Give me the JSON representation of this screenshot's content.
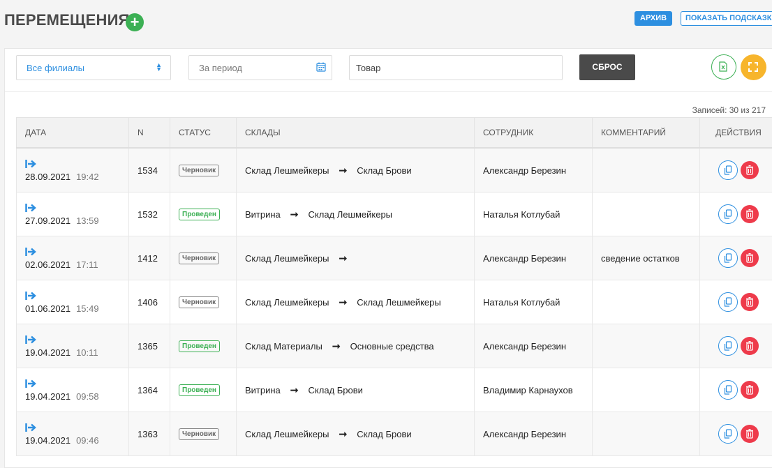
{
  "header": {
    "title": "ПЕРЕМЕЩЕНИЯ",
    "add_icon": "plus-icon",
    "archive_label": "АРХИВ",
    "hint_label": "ПОКАЗАТЬ ПОДСКАЗКУ"
  },
  "filters": {
    "branch_value": "Все филиалы",
    "period_placeholder": "За период",
    "product_placeholder": "Товар",
    "reset_label": "СБРОС"
  },
  "records_text": "Записей: 30 из 217",
  "table": {
    "columns": [
      "ДАТА",
      "N",
      "СТАТУС",
      "СКЛАДЫ",
      "СОТРУДНИК",
      "КОММЕНТАРИЙ",
      "ДЕЙСТВИЯ"
    ],
    "rows": [
      {
        "date": "28.09.2021",
        "time": "19:42",
        "n": "1534",
        "status": "Черновик",
        "status_type": "draft",
        "from": "Склад Лешмейкеры",
        "to": "Склад Брови",
        "employee": "Александр Березин",
        "comment": ""
      },
      {
        "date": "27.09.2021",
        "time": "13:59",
        "n": "1532",
        "status": "Проведен",
        "status_type": "done",
        "from": "Витрина",
        "to": "Склад Лешмейкеры",
        "employee": "Наталья Котлубай",
        "comment": ""
      },
      {
        "date": "02.06.2021",
        "time": "17:11",
        "n": "1412",
        "status": "Черновик",
        "status_type": "draft",
        "from": "Склад Лешмейкеры",
        "to": "",
        "employee": "Александр Березин",
        "comment": "сведение остатков"
      },
      {
        "date": "01.06.2021",
        "time": "15:49",
        "n": "1406",
        "status": "Черновик",
        "status_type": "draft",
        "from": "Склад Лешмейкеры",
        "to": "Склад Лешмейкеры",
        "employee": "Наталья Котлубай",
        "comment": ""
      },
      {
        "date": "19.04.2021",
        "time": "10:11",
        "n": "1365",
        "status": "Проведен",
        "status_type": "done",
        "from": "Склад Материалы",
        "to": "Основные средства",
        "employee": "Александр Березин",
        "comment": ""
      },
      {
        "date": "19.04.2021",
        "time": "09:58",
        "n": "1364",
        "status": "Проведен",
        "status_type": "done",
        "from": "Витрина",
        "to": "Склад Брови",
        "employee": "Владимир Карнаухов",
        "comment": ""
      },
      {
        "date": "19.04.2021",
        "time": "09:46",
        "n": "1363",
        "status": "Черновик",
        "status_type": "draft",
        "from": "Склад Лешмейкеры",
        "to": "Склад Брови",
        "employee": "Александр Березин",
        "comment": ""
      }
    ]
  },
  "colors": {
    "accent": "#2d8fe0",
    "success": "#3cb054",
    "danger": "#ee3b4b",
    "warning": "#f7b52c"
  }
}
